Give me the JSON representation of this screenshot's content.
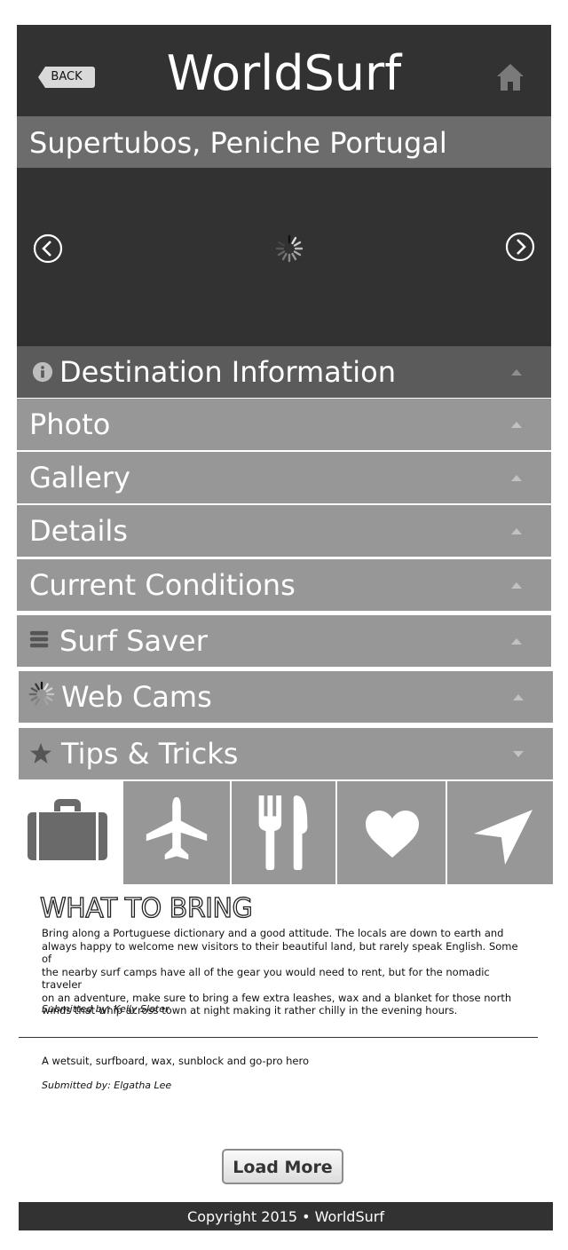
{
  "header": {
    "back_label": "BACK",
    "title": "WorldSurf",
    "home_icon": "home-icon"
  },
  "location": {
    "title": "Supertubos, Peniche Portugal"
  },
  "slider": {
    "prev_icon": "chevron-left-circle-icon",
    "next_icon": "chevron-right-circle-icon",
    "loading_icon": "spinner-icon"
  },
  "accordion": [
    {
      "label": "Destination Information",
      "icon": "info-icon",
      "expanded": true
    },
    {
      "label": "Photo"
    },
    {
      "label": "Gallery"
    },
    {
      "label": "Details"
    },
    {
      "label": "Current Conditions"
    },
    {
      "label": "Surf Saver",
      "icon": "stack-icon"
    },
    {
      "label": "Web Cams",
      "icon": "spinner-icon"
    },
    {
      "label": "Tips & Tricks",
      "icon": "star-icon",
      "expanded": true
    }
  ],
  "tabs": [
    {
      "icon": "suitcase-icon",
      "active": true
    },
    {
      "icon": "airplane-icon"
    },
    {
      "icon": "fork-knife-icon"
    },
    {
      "icon": "heart-icon"
    },
    {
      "icon": "navigation-arrow-icon"
    }
  ],
  "what_to_bring": {
    "title": "WHAT TO BRING",
    "tips": [
      {
        "lines": [
          "Bring along a Portuguese dictionary and a good attitude. The locals are down to earth and",
          "always happy to welcome new visitors to their beautiful land, but rarely speak English. Some of",
          "the nearby surf camps have all of the gear you would need to rent, but for the nomadic traveler",
          "on an adventure, make sure to bring a few extra leashes, wax and a blanket for those north",
          "winds that whip across town at night making it rather chilly in the evening hours."
        ],
        "author": "Submitted by: Kelly Slater"
      },
      {
        "lines": [
          "A wetsuit, surfboard, wax, sunblock and go-pro hero"
        ],
        "author": "Submitted by: Elgatha Lee"
      }
    ]
  },
  "load_more_label": "Load More",
  "footer": {
    "copyright": "Copyright 2015 • WorldSurf"
  },
  "colors": {
    "dark": "#323232",
    "header_bar": "#6c6c6c",
    "accordion": "#979797",
    "accordion_active": "#5b5b5b"
  }
}
